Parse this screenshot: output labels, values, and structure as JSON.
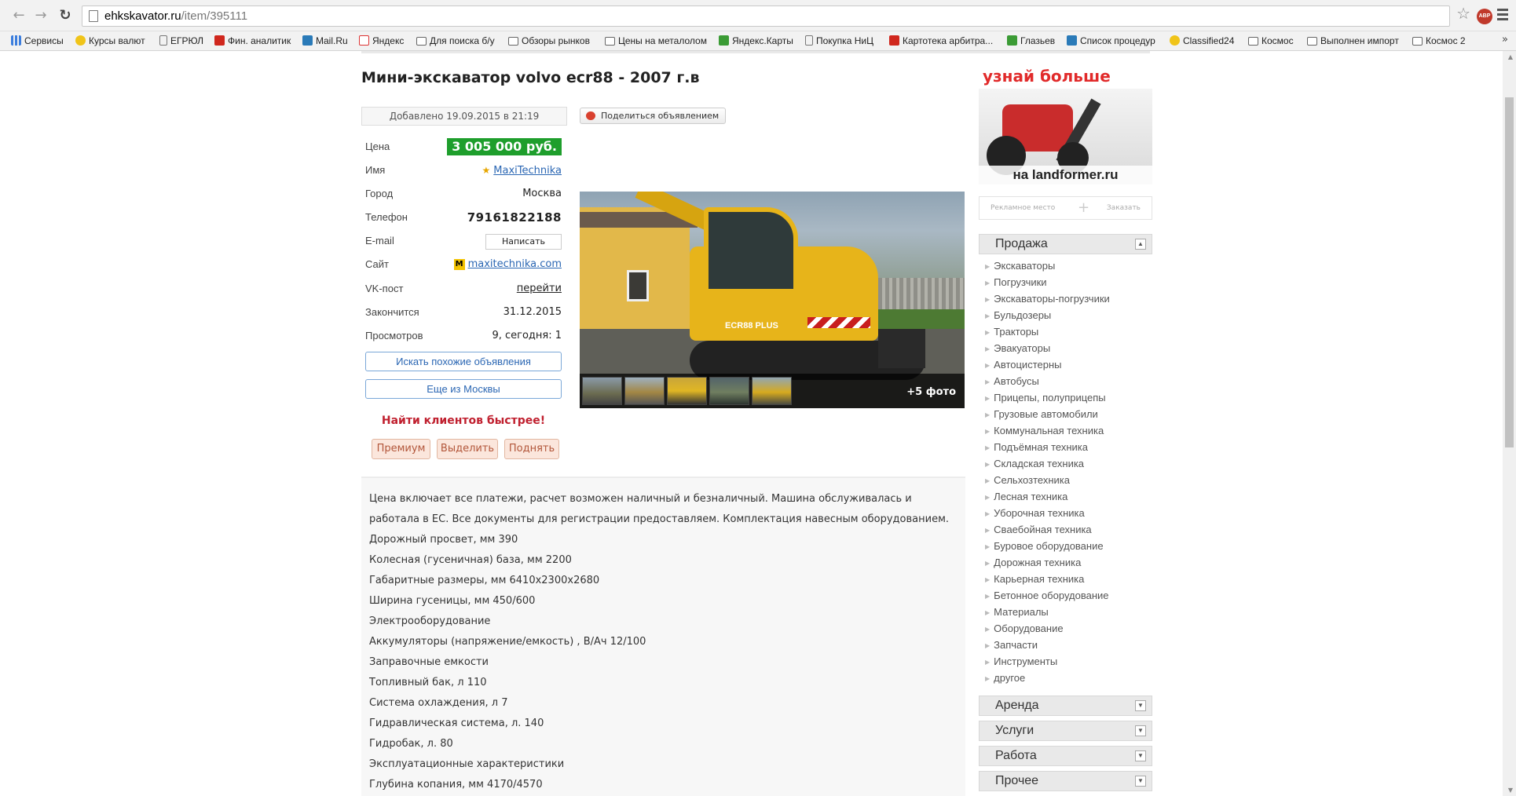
{
  "browser": {
    "url_host": "ehkskavator.ru",
    "url_path": "/item/395111",
    "bookmarks": [
      {
        "label": "Сервисы",
        "icon": "apps-grid-icon"
      },
      {
        "label": "Курсы валют",
        "icon": "smiley-icon"
      },
      {
        "label": "ЕГРЮЛ",
        "icon": "page-icon"
      },
      {
        "label": "Фин. аналитик",
        "icon": "fin-analytic-icon"
      },
      {
        "label": "Mail.Ru",
        "icon": "mailru-icon"
      },
      {
        "label": "Яндекс",
        "icon": "yandex-icon"
      },
      {
        "label": "Для поиска б/у",
        "icon": "folder-icon"
      },
      {
        "label": "Обзоры рынков",
        "icon": "folder-icon"
      },
      {
        "label": "Цены на металолом",
        "icon": "folder-icon"
      },
      {
        "label": "Яндекс.Карты",
        "icon": "yandex-maps-icon"
      },
      {
        "label": "Покупка НиЦ",
        "icon": "page-icon"
      },
      {
        "label": "Картотека арбитра...",
        "icon": "arbitr-icon"
      },
      {
        "label": "Глазьев",
        "icon": "glaziev-icon"
      },
      {
        "label": "Список процедур",
        "icon": "procedures-icon"
      },
      {
        "label": "Classified24",
        "icon": "classified-icon"
      },
      {
        "label": "Космос",
        "icon": "folder-icon"
      },
      {
        "label": "Выполнен импорт",
        "icon": "folder-icon"
      },
      {
        "label": "Космос 2",
        "icon": "folder-icon"
      }
    ],
    "more": "»"
  },
  "listing": {
    "title": "Мини-экскаватор volvo ecr88 - 2007 г.в",
    "added": "Добавлено 19.09.2015 в 21:19",
    "share": "Поделиться объявлением",
    "price_label": "Цена",
    "price": "3 005 000 руб.",
    "name_label": "Имя",
    "name": "MaxiTechnika",
    "city_label": "Город",
    "city": "Москва",
    "phone_label": "Телефон",
    "phone": "79161822188",
    "email_label": "E-mail",
    "email_button": "Написать",
    "site_label": "Сайт",
    "site": "maxitechnika.com",
    "vk_label": "VK-пост",
    "vk": "перейти",
    "ends_label": "Закончится",
    "ends": "31.12.2015",
    "views_label": "Просмотров",
    "views": "9, сегодня: 1",
    "similar_button": "Искать похожие объявления",
    "more_moscow_button": "Еще из Москвы",
    "promo_title": "Найти клиентов быстрее!",
    "promo_buttons": [
      "Премиум",
      "Выделить",
      "Поднять"
    ],
    "photo_caption": "ECR88 PLUS",
    "more_photos": "+5 фото"
  },
  "description": [
    "Цена включает все платежи, расчет возможен наличный и безналичный. Машина обслуживалась и",
    "работала в ЕС. Все документы для регистрации предоставляем. Комплектация навесным оборудованием.",
    "Дорожный просвет, мм 390",
    "Колесная (гусеничная) база, мм 2200",
    "Габаритные размеры, мм 6410x2300x2680",
    "Ширина гусеницы, мм 450/600",
    "Электрооборудование",
    "Аккумуляторы (напряжение/емкость) , В/Ач 12/100",
    "Заправочные емкости",
    "Топливный бак, л 110",
    "Система охлаждения, л 7",
    "Гидравлическая система, л. 140",
    "Гидробак, л. 80",
    "Эксплуатационные характеристики",
    "Глубина копания, мм 4170/4570"
  ],
  "sidebar": {
    "banner_title": "узнай больше",
    "banner_footer": "на landformer.ru",
    "ad_place": "Рекламное место",
    "ad_order": "Заказать",
    "sale_heading": "Продажа",
    "categories": [
      "Экскаваторы",
      "Погрузчики",
      "Экскаваторы-погрузчики",
      "Бульдозеры",
      "Тракторы",
      "Эвакуаторы",
      "Автоцистерны",
      "Автобусы",
      "Прицепы, полуприцепы",
      "Грузовые автомобили",
      "Коммунальная техника",
      "Подъёмная техника",
      "Складская техника",
      "Сельхозтехника",
      "Лесная техника",
      "Уборочная техника",
      "Свaебойная техника",
      "Буровое оборудование",
      "Дорожная техника",
      "Карьерная техника",
      "Бетонное оборудование",
      "Материалы",
      "Оборудование",
      "Запчасти",
      "Инструменты",
      "другое"
    ],
    "other_sections": [
      "Аренда",
      "Услуги",
      "Работа",
      "Прочее"
    ]
  }
}
